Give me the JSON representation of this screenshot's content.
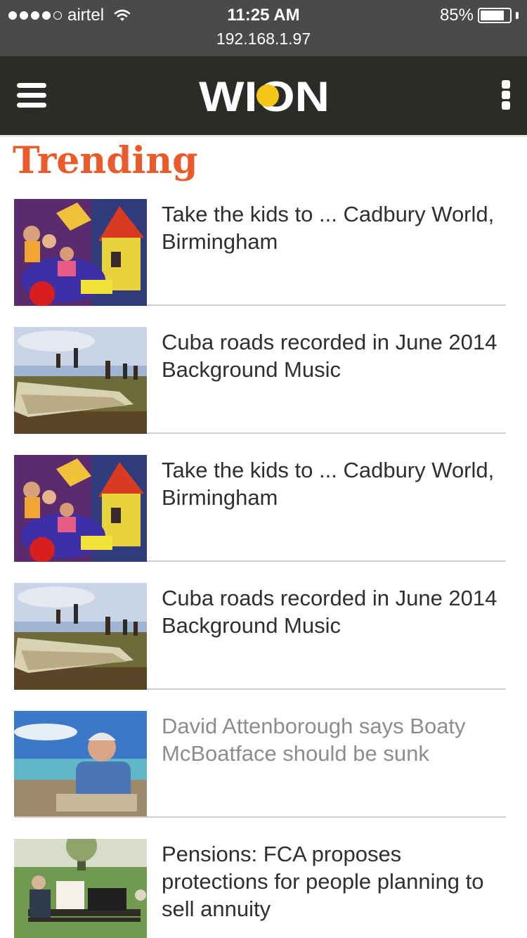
{
  "status_bar": {
    "carrier": "airtel",
    "time": "11:25 AM",
    "url": "192.168.1.97",
    "battery": "85%",
    "battery_level": 0.85
  },
  "header": {
    "logo_text": "WION",
    "menu_icon": "hamburger-menu-icon",
    "more_icon": "vertical-dots-icon",
    "accent_color": "#f5c518",
    "background_color": "#2d2b27"
  },
  "section": {
    "title": "Trending",
    "title_color": "#ea5b2c"
  },
  "articles": [
    {
      "title": "Take the kids to ... Cadbury World, Birmingham",
      "image": "cadbury-world-ride",
      "visited": false
    },
    {
      "title": "Cuba roads recorded in June 2014 Background Music",
      "image": "plane-wreck-kids",
      "visited": false
    },
    {
      "title": "Take the kids to ... Cadbury World, Birmingham",
      "image": "cadbury-world-ride",
      "visited": false
    },
    {
      "title": "Cuba roads recorded in June 2014 Background Music",
      "image": "plane-wreck-kids",
      "visited": false
    },
    {
      "title": "David Attenborough says Boaty McBoatface should be sunk",
      "image": "man-on-beach",
      "visited": true
    },
    {
      "title": "Pensions: FCA proposes protections for people planning to sell annuity",
      "image": "park-bench-readers",
      "visited": false
    }
  ]
}
